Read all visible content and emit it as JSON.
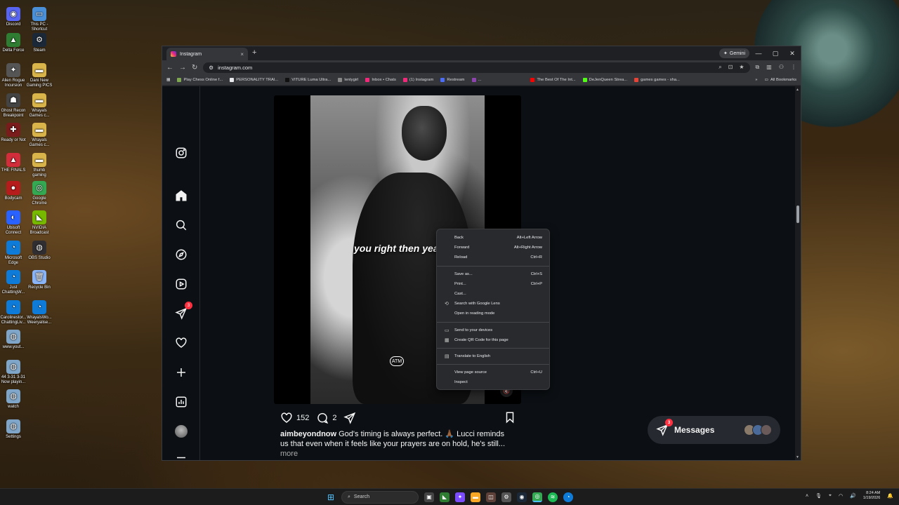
{
  "desktop": {
    "icons": [
      {
        "label": "Discord",
        "color": "#5865f2",
        "glyph": "◉"
      },
      {
        "label": "This PC - Shortcut",
        "color": "#4a90d9",
        "glyph": "▭"
      },
      {
        "label": "Delta Force",
        "color": "#2e7d32",
        "glyph": "▲"
      },
      {
        "label": "Steam",
        "color": "#1b2838",
        "glyph": "⚙"
      },
      {
        "label": "Alien Rogue Incursion",
        "color": "#555",
        "glyph": "✦"
      },
      {
        "label": "Dani New Gaming PICS",
        "color": "#d8b44a",
        "glyph": "▬"
      },
      {
        "label": "Ghost Recon Breakpoint",
        "color": "#444",
        "glyph": "☗"
      },
      {
        "label": "Wrayals Games c...",
        "color": "#d8b44a",
        "glyph": "▬"
      },
      {
        "label": "Ready or Not",
        "color": "#7a1c1c",
        "glyph": "✚"
      },
      {
        "label": "Wrayals Games c...",
        "color": "#d8b44a",
        "glyph": "▬"
      },
      {
        "label": "THE FINALS",
        "color": "#d12d3a",
        "glyph": "▲"
      },
      {
        "label": "thumb gaming",
        "color": "#d8b44a",
        "glyph": "▬"
      },
      {
        "label": "Bodycam",
        "color": "#b71c1c",
        "glyph": "●"
      },
      {
        "label": "Google Chrome",
        "color": "#34a853",
        "glyph": "◎"
      },
      {
        "label": "Ubisoft Connect",
        "color": "#2962ff",
        "glyph": "◐"
      },
      {
        "label": "NVIDIA Broadcast",
        "color": "#76b900",
        "glyph": "◣"
      },
      {
        "label": "Microsoft Edge",
        "color": "#0f7bd8",
        "glyph": "◔"
      },
      {
        "label": "OBS Studio",
        "color": "#302e31",
        "glyph": "◍"
      },
      {
        "label": "Just ChattingW...",
        "color": "#0f7bd8",
        "glyph": "◔"
      },
      {
        "label": "Recycle Bin",
        "color": "#8ab4f8",
        "glyph": "🗑"
      },
      {
        "label": "Carolinestor... ChattingLiv...",
        "color": "#0f7bd8",
        "glyph": "◔"
      },
      {
        "label": "WrayalsWo... Weeryalise...",
        "color": "#0f7bd8",
        "glyph": "◔"
      },
      {
        "label": "www.yout...",
        "color": "#7fa6c9",
        "glyph": "◍"
      },
      {
        "label": "44 3-31 3-31 Now playin...",
        "color": "#7fa6c9",
        "glyph": "◍"
      },
      {
        "label": "watch",
        "color": "#7fa6c9",
        "glyph": "◍"
      },
      {
        "label": "Settings",
        "color": "#7fa6c9",
        "glyph": "◍"
      }
    ]
  },
  "browser": {
    "tab_title": "Instagram",
    "tab_close": "×",
    "new_tab": "+",
    "gemini_label": "Gemini",
    "url": "instagram.com",
    "bookmarks": [
      {
        "label": "Play Chess Online f...",
        "color": "#7fa650"
      },
      {
        "label": "PERSONALITY TRAI...",
        "color": "#e8eaed"
      },
      {
        "label": "VITURE Luma Ultra...",
        "color": "#111"
      },
      {
        "label": "lentygirl",
        "color": "#888"
      },
      {
        "label": "Inbox • Chats",
        "color": "#ee2a7b"
      },
      {
        "label": "(1) Instagram",
        "color": "#ee2a7b"
      },
      {
        "label": "Restream",
        "color": "#4a6cf7"
      },
      {
        "label": "...",
        "color": "#8e44ad"
      },
      {
        "label": "The Best Of The Int...",
        "color": "#ff0000"
      },
      {
        "label": "DeJenQueen Strea...",
        "color": "#53fc18"
      },
      {
        "label": "games games - sha...",
        "color": "#ea4335"
      }
    ],
    "all_bookmarks": "All Bookmarks"
  },
  "instagram": {
    "sidebar_badge_notifications": "3",
    "video_caption": "you right then yeah",
    "reel_mark": "ATM",
    "likes": "152",
    "comments": "2",
    "caption_user": "aimbeyondnow",
    "caption_text": "God's timing is always perfect. 🙏🏾 Lucci reminds us that even when it feels like your prayers are on hold, he's still...",
    "caption_more": "more",
    "messages_label": "Messages",
    "messages_badge": "3"
  },
  "context_menu": {
    "groups": [
      [
        {
          "label": "Back",
          "shortcut": "Alt+Left Arrow"
        },
        {
          "label": "Forward",
          "shortcut": "Alt+Right Arrow"
        },
        {
          "label": "Reload",
          "shortcut": "Ctrl+R"
        }
      ],
      [
        {
          "label": "Save as...",
          "shortcut": "Ctrl+S"
        },
        {
          "label": "Print...",
          "shortcut": "Ctrl+P"
        },
        {
          "label": "Cast...",
          "shortcut": ""
        },
        {
          "label": "Search with Google Lens",
          "shortcut": "",
          "icon": "⟲"
        },
        {
          "label": "Open in reading mode",
          "shortcut": ""
        }
      ],
      [
        {
          "label": "Send to your devices",
          "shortcut": "",
          "icon": "▭"
        },
        {
          "label": "Create QR Code for this page",
          "shortcut": "",
          "icon": "▦"
        }
      ],
      [
        {
          "label": "Translate to English",
          "shortcut": "",
          "icon": "▤"
        }
      ],
      [
        {
          "label": "View page source",
          "shortcut": "Ctrl+U"
        },
        {
          "label": "Inspect",
          "shortcut": ""
        }
      ]
    ]
  },
  "taskbar": {
    "search_label": "Search",
    "time": "8:24 AM",
    "date": "1/19/2026"
  }
}
